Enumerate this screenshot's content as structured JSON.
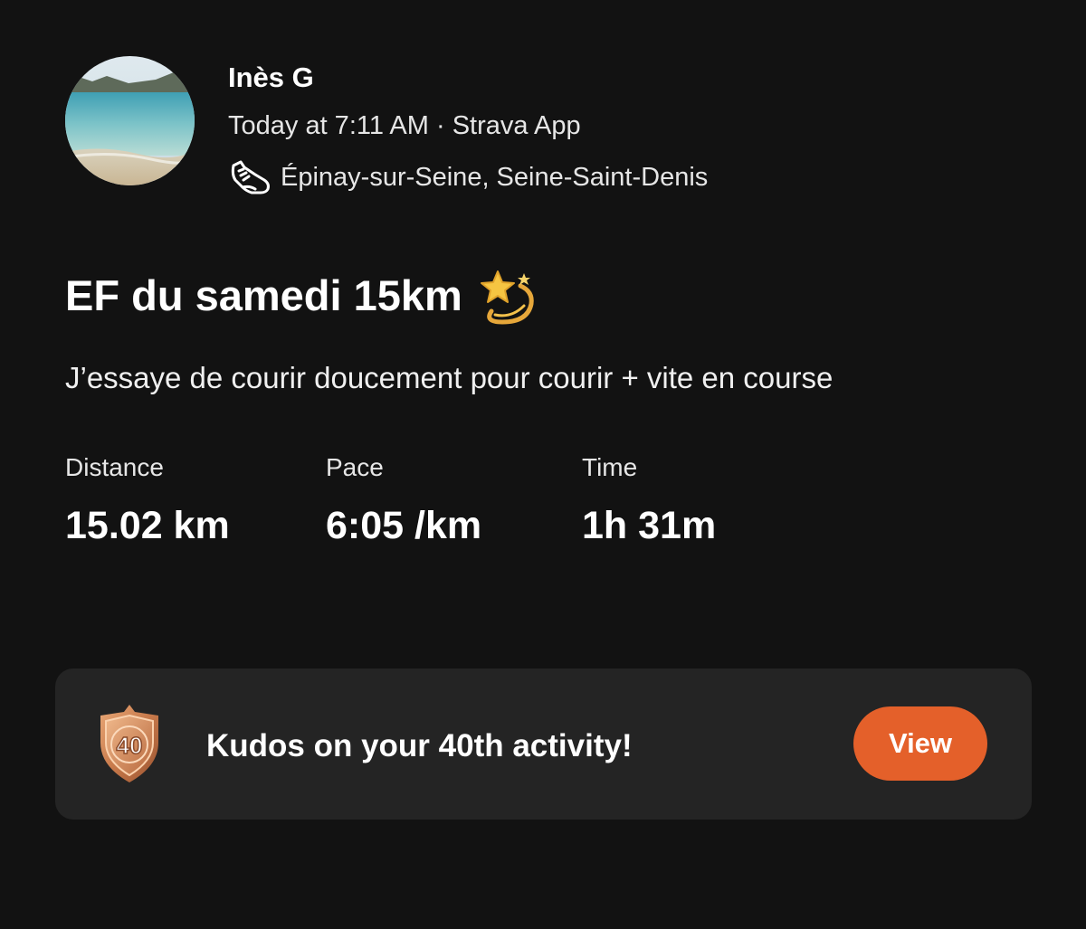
{
  "activity": {
    "athlete_name": "Inès G",
    "timestamp": "Today at 7:11 AM · Strava App",
    "location": "Épinay-sur-Seine, Seine-Saint-Denis",
    "activity_type_icon": "running-shoe-icon",
    "title": "EF du samedi 15km",
    "title_emoji": "dizzy-star-emoji",
    "description": "J’essaye de courir doucement pour courir + vite en course",
    "stats": [
      {
        "label": "Distance",
        "value": "15.02 km"
      },
      {
        "label": "Pace",
        "value": "6:05 /km"
      },
      {
        "label": "Time",
        "value": "1h 31m"
      }
    ]
  },
  "kudos": {
    "badge_number": "40",
    "badge_icon": "bronze-shield-badge-icon",
    "message": "Kudos on your 40th activity!",
    "button_label": "View"
  },
  "colors": {
    "background": "#121212",
    "card": "#242424",
    "accent": "#e4602a",
    "text_primary": "#ffffff",
    "text_secondary": "#e6e6e6"
  }
}
